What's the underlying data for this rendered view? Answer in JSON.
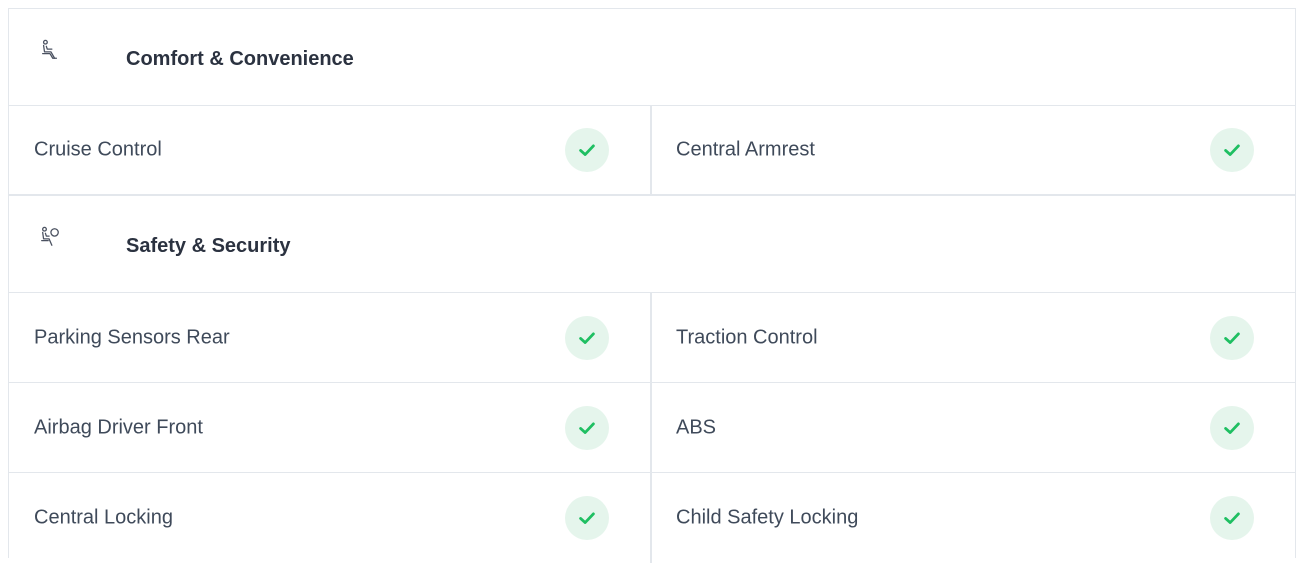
{
  "sections": [
    {
      "title": "Comfort & Convenience",
      "icon": "seat-icon",
      "rows": [
        [
          "Cruise Control",
          "Central Armrest"
        ]
      ]
    },
    {
      "title": "Safety & Security",
      "icon": "airbag-icon",
      "rows": [
        [
          "Parking Sensors Rear",
          "Traction Control"
        ],
        [
          "Airbag Driver Front",
          "ABS"
        ],
        [
          "Central Locking",
          "Child Safety Locking"
        ]
      ]
    }
  ],
  "colors": {
    "check_green": "#1fbf62",
    "check_bg": "#e5f5ec",
    "border": "#e3e7ec"
  }
}
